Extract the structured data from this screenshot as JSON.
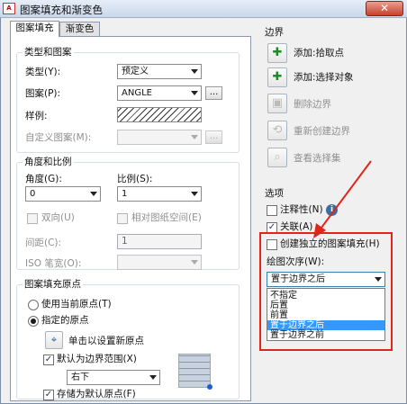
{
  "window": {
    "title": "图案填充和渐变色",
    "app_icon_text": "A",
    "close_symbol": "✕"
  },
  "tabs": [
    {
      "label": "图案填充",
      "active": true
    },
    {
      "label": "渐变色",
      "active": false
    }
  ],
  "type_pattern": {
    "group_title": "类型和图案",
    "type_label": "类型(Y):",
    "type_value": "预定义",
    "pattern_label": "图案(P):",
    "pattern_value": "ANGLE",
    "sample_label": "样例:",
    "custom_label": "自定义图案(M):",
    "browse_label": "..."
  },
  "angle_scale": {
    "group_title": "角度和比例",
    "angle_label": "角度(G):",
    "angle_value": "0",
    "scale_label": "比例(S):",
    "scale_value": "1",
    "double_label": "双向(U)",
    "relative_label": "相对图纸空间(E)",
    "spacing_label": "间距(C):",
    "spacing_value": "1",
    "iso_label": "ISO 笔宽(O):"
  },
  "origin": {
    "group_title": "图案填充原点",
    "use_current": "使用当前原点(T)",
    "specified": "指定的原点",
    "click_set": "单击以设置新原点",
    "default_extent": "默认为边界范围(X)",
    "position_value": "右下",
    "store_default": "存储为默认原点(F)"
  },
  "boundaries": {
    "title": "边界",
    "add_pick": "添加:拾取点",
    "add_select": "添加:选择对象",
    "remove": "删除边界",
    "recreate": "重新创建边界",
    "view": "查看选择集"
  },
  "options": {
    "title": "选项",
    "annotative": "注释性(N)",
    "associative": "关联(A)",
    "create_separate": "创建独立的图案填充(H)",
    "draw_order_label": "绘图次序(W):",
    "draw_order_value": "置于边界之后",
    "draw_order_options": [
      "不指定",
      "后置",
      "前置",
      "置于边界之后",
      "置于边界之前"
    ],
    "highlighted_option_index": 3
  },
  "colors": {
    "highlight": "#e0261b",
    "selection": "#3399ff"
  }
}
